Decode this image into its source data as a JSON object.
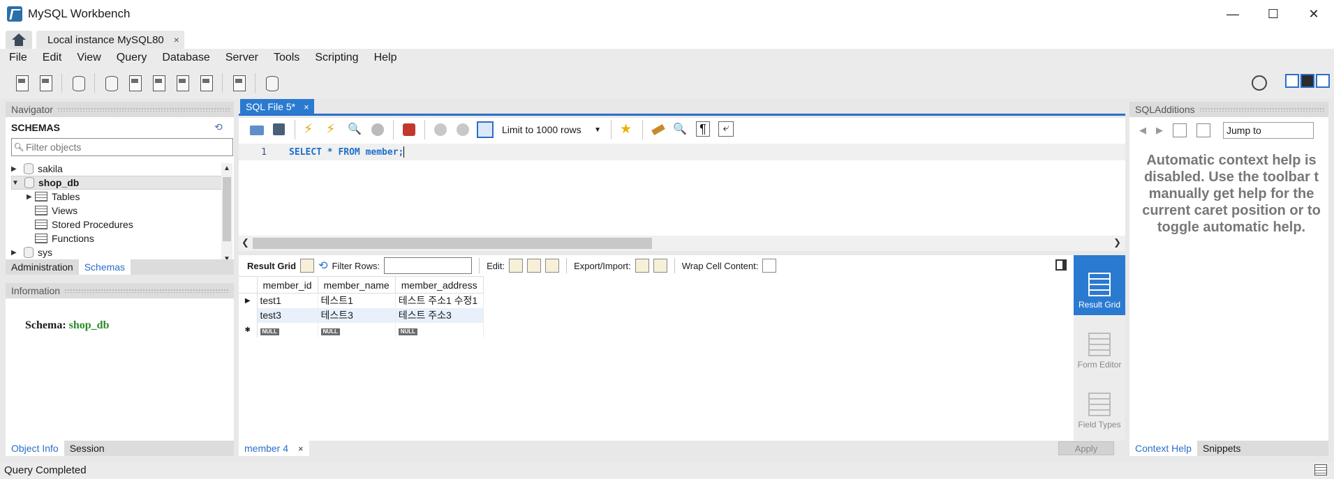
{
  "window": {
    "title": "MySQL Workbench",
    "minimize": "—",
    "maximize": "☐",
    "close": "✕"
  },
  "tabs": {
    "connection_tab": "Local instance MySQL80",
    "close": "×"
  },
  "menu": [
    "File",
    "Edit",
    "View",
    "Query",
    "Database",
    "Server",
    "Tools",
    "Scripting",
    "Help"
  ],
  "navigator": {
    "header": "Navigator",
    "schemas_title": "SCHEMAS",
    "filter_placeholder": "Filter objects",
    "tree": [
      {
        "label": "sakila",
        "arrow": "▶"
      },
      {
        "label": "shop_db",
        "arrow": "▼"
      },
      {
        "label": "Tables",
        "arrow": "▶"
      },
      {
        "label": "Views"
      },
      {
        "label": "Stored Procedures"
      },
      {
        "label": "Functions"
      },
      {
        "label": "sys",
        "arrow": "▶"
      }
    ],
    "tabs": [
      "Administration",
      "Schemas"
    ]
  },
  "information": {
    "header": "Information",
    "schema_label": "Schema:",
    "schema_value": "shop_db",
    "tabs": [
      "Object Info",
      "Session"
    ]
  },
  "editor": {
    "tab_label": "SQL File 5*",
    "tab_close": "×",
    "limit_label": "Limit to 1000 rows",
    "line_number": "1",
    "code": "SELECT * FROM member;"
  },
  "result": {
    "result_grid_label": "Result Grid",
    "filter_rows_label": "Filter Rows:",
    "edit_label": "Edit:",
    "export_label": "Export/Import:",
    "wrap_label": "Wrap Cell Content:",
    "columns": [
      "member_id",
      "member_name",
      "member_address"
    ],
    "rows": [
      [
        "test1",
        "테스트1",
        "테스트 주소1 수정1"
      ],
      [
        "test3",
        "테스트3",
        "테스트 주소3"
      ]
    ],
    "null_label": "NULL",
    "side_tabs": [
      {
        "label": "Result Grid"
      },
      {
        "label": "Form Editor"
      },
      {
        "label": "Field Types"
      }
    ],
    "footer_tab": "member 4",
    "footer_close": "×",
    "apply_label": "Apply"
  },
  "additions": {
    "header": "SQLAdditions",
    "jump_to": "Jump to",
    "help_text": "Automatic context help is disabled. Use the toolbar t manually get help for the current caret position or to toggle automatic help.",
    "tabs": [
      "Context Help",
      "Snippets"
    ]
  },
  "status": {
    "text": "Query Completed"
  }
}
